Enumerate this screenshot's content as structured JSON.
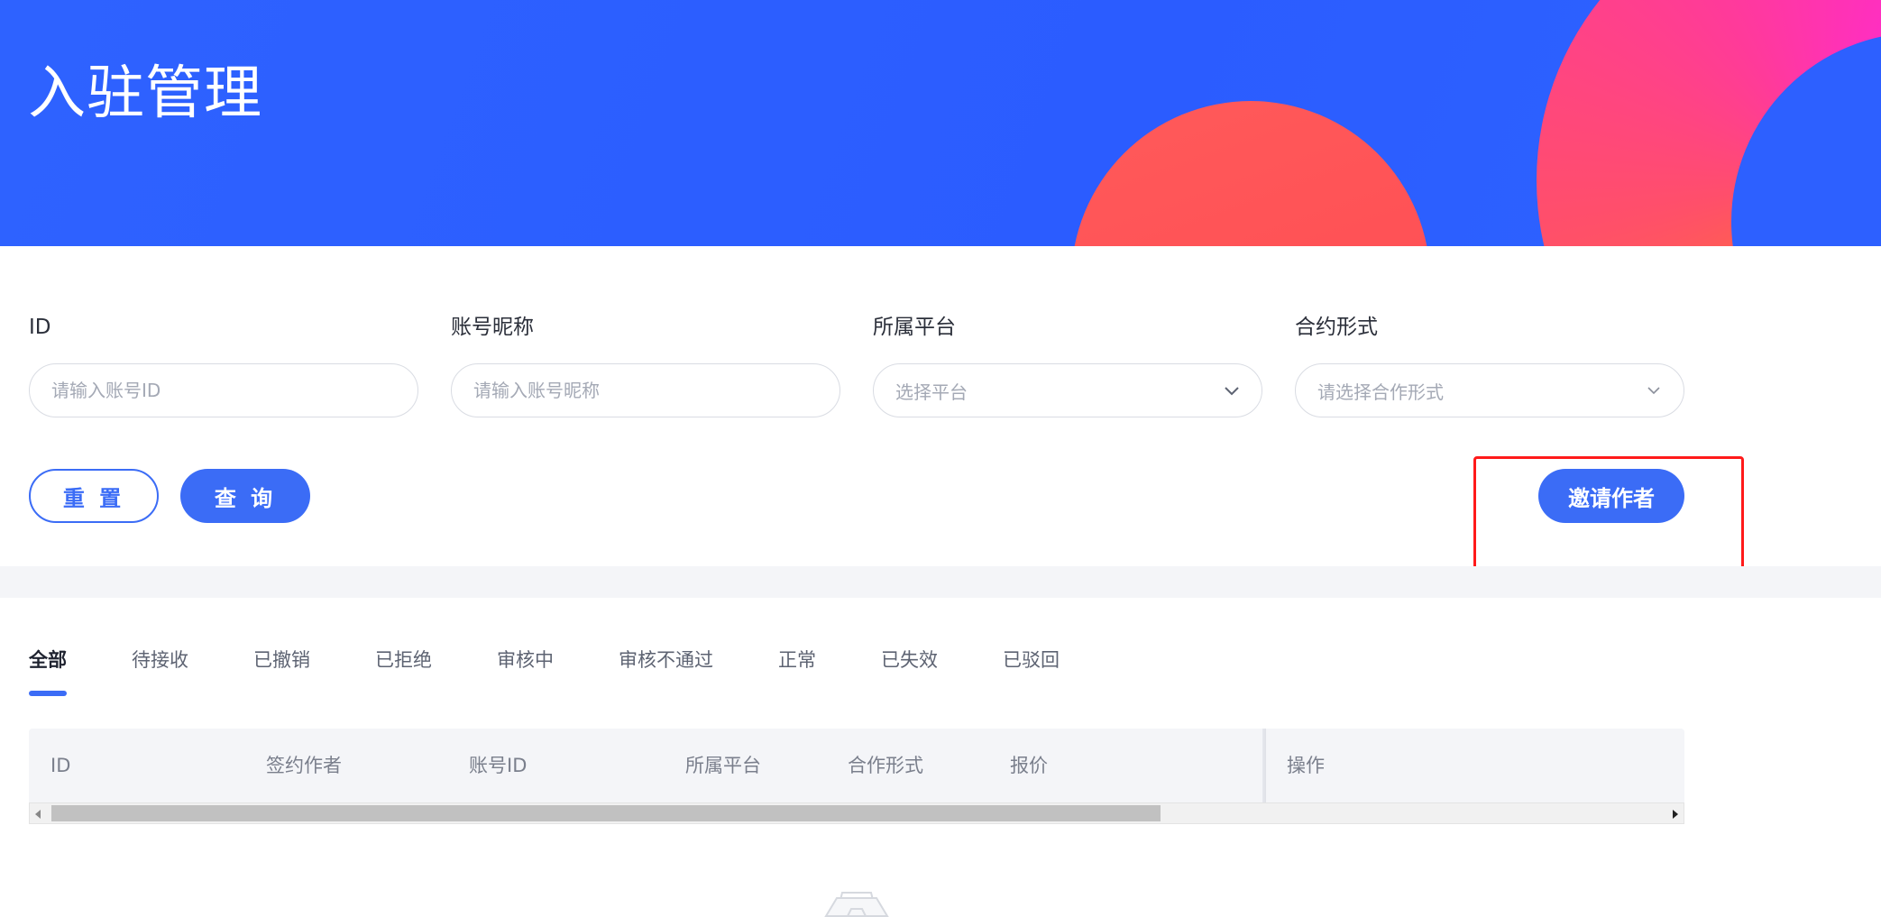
{
  "header": {
    "title": "入驻管理"
  },
  "filters": {
    "id": {
      "label": "ID",
      "placeholder": "请输入账号ID"
    },
    "nickname": {
      "label": "账号昵称",
      "placeholder": "请输入账号昵称"
    },
    "platform": {
      "label": "所属平台",
      "placeholder": "选择平台"
    },
    "contract": {
      "label": "合约形式",
      "placeholder": "请选择合作形式"
    }
  },
  "actions": {
    "reset": "重 置",
    "query": "查 询",
    "invite": "邀请作者"
  },
  "tabs": [
    {
      "label": "全部",
      "active": true
    },
    {
      "label": "待接收"
    },
    {
      "label": "已撤销"
    },
    {
      "label": "已拒绝"
    },
    {
      "label": "审核中"
    },
    {
      "label": "审核不通过"
    },
    {
      "label": "正常"
    },
    {
      "label": "已失效"
    },
    {
      "label": "已驳回"
    }
  ],
  "table": {
    "columns": [
      "ID",
      "签约作者",
      "账号ID",
      "所属平台",
      "合作形式",
      "报价",
      "操作"
    ]
  },
  "colors": {
    "brand": "#3b6cf6",
    "banner": "#2e62ff",
    "highlight": "#ff1a1a"
  },
  "icons": [
    "chevron-down-icon",
    "empty-box-icon"
  ]
}
